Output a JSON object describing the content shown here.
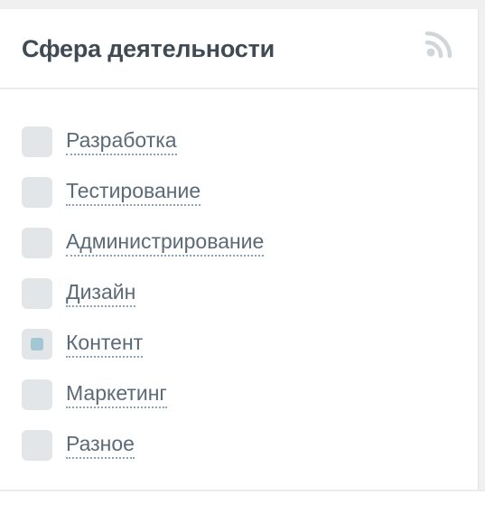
{
  "widget": {
    "title": "Сфера деятельности",
    "rss_icon": "rss-feed-icon",
    "colors": {
      "title": "#3f4a54",
      "label": "#5b6a77",
      "checkbox_bg": "#e3e6e9",
      "checked_mark": "#a2c6d4",
      "icon": "#d2d6d9"
    }
  },
  "filters": [
    {
      "label": "Разработка",
      "checked": false
    },
    {
      "label": "Тестирование",
      "checked": false
    },
    {
      "label": "Администрирование",
      "checked": false
    },
    {
      "label": "Дизайн",
      "checked": false
    },
    {
      "label": "Контент",
      "checked": true
    },
    {
      "label": "Маркетинг",
      "checked": false
    },
    {
      "label": "Разное",
      "checked": false
    }
  ]
}
